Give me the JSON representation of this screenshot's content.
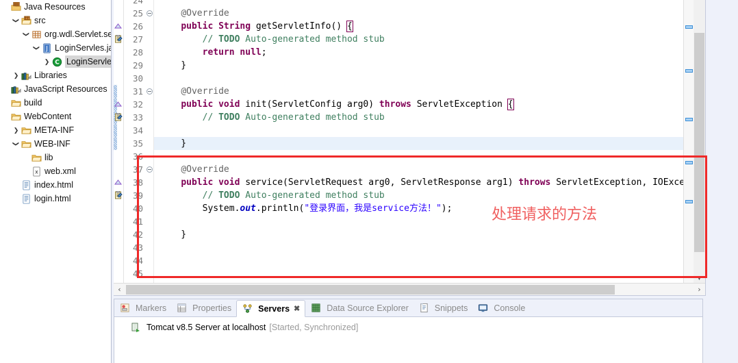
{
  "explorer": {
    "items": [
      {
        "label": "Java Resources",
        "icon": "java-resources-icon",
        "arrow": "",
        "indent": 0,
        "selected": false
      },
      {
        "label": "src",
        "icon": "source-folder-icon",
        "arrow": "v",
        "indent": 1,
        "selected": false
      },
      {
        "label": "org.wdl.Servlet.ser",
        "icon": "package-icon",
        "arrow": "v",
        "indent": 2,
        "selected": false
      },
      {
        "label": "LoginServles.jav",
        "icon": "java-file-icon",
        "arrow": "v",
        "indent": 3,
        "selected": false
      },
      {
        "label": "LoginServles",
        "icon": "java-class-icon",
        "arrow": ">",
        "indent": 4,
        "selected": true
      },
      {
        "label": "Libraries",
        "icon": "libraries-icon",
        "arrow": ">",
        "indent": 1,
        "selected": false
      },
      {
        "label": "JavaScript Resources",
        "icon": "libraries-icon",
        "arrow": "",
        "indent": 0,
        "selected": false
      },
      {
        "label": "build",
        "icon": "folder-icon",
        "arrow": "",
        "indent": 0,
        "selected": false
      },
      {
        "label": "WebContent",
        "icon": "folder-icon",
        "arrow": "",
        "indent": 0,
        "selected": false
      },
      {
        "label": "META-INF",
        "icon": "folder-icon",
        "arrow": ">",
        "indent": 1,
        "selected": false
      },
      {
        "label": "WEB-INF",
        "icon": "folder-icon",
        "arrow": "v",
        "indent": 1,
        "selected": false
      },
      {
        "label": "lib",
        "icon": "folder-icon",
        "arrow": "",
        "indent": 2,
        "selected": false
      },
      {
        "label": "web.xml",
        "icon": "xml-file-icon",
        "arrow": "",
        "indent": 2,
        "selected": false
      },
      {
        "label": "index.html",
        "icon": "html-file-icon",
        "arrow": "",
        "indent": 1,
        "selected": false
      },
      {
        "label": "login.html",
        "icon": "html-file-icon",
        "arrow": "",
        "indent": 1,
        "selected": false
      }
    ]
  },
  "editor": {
    "first_visible_line": 24,
    "lines": [
      {
        "n": 24,
        "text": "",
        "fold": false,
        "marker": "",
        "changebar": false,
        "current": false
      },
      {
        "n": 25,
        "text": "    @Override",
        "fold": true,
        "marker": "",
        "changebar": false,
        "current": false
      },
      {
        "n": 26,
        "text": "    public String getServletInfo() {",
        "fold": false,
        "marker": "override",
        "changebar": false,
        "current": false
      },
      {
        "n": 27,
        "text": "        // TODO Auto-generated method stub",
        "fold": false,
        "marker": "todo",
        "changebar": false,
        "current": false
      },
      {
        "n": 28,
        "text": "        return null;",
        "fold": false,
        "marker": "",
        "changebar": false,
        "current": false
      },
      {
        "n": 29,
        "text": "    }",
        "fold": false,
        "marker": "",
        "changebar": false,
        "current": false
      },
      {
        "n": 30,
        "text": "",
        "fold": false,
        "marker": "",
        "changebar": false,
        "current": false
      },
      {
        "n": 31,
        "text": "    @Override",
        "fold": true,
        "marker": "",
        "changebar": true,
        "current": false
      },
      {
        "n": 32,
        "text": "    public void init(ServletConfig arg0) throws ServletException {",
        "fold": false,
        "marker": "override",
        "changebar": true,
        "current": false
      },
      {
        "n": 33,
        "text": "        // TODO Auto-generated method stub",
        "fold": false,
        "marker": "todo",
        "changebar": true,
        "current": false
      },
      {
        "n": 34,
        "text": "",
        "fold": false,
        "marker": "",
        "changebar": true,
        "current": false
      },
      {
        "n": 35,
        "text": "    }",
        "fold": false,
        "marker": "",
        "changebar": true,
        "current": true
      },
      {
        "n": 36,
        "text": "",
        "fold": false,
        "marker": "",
        "changebar": false,
        "current": false
      },
      {
        "n": 37,
        "text": "    @Override",
        "fold": true,
        "marker": "",
        "changebar": false,
        "current": false
      },
      {
        "n": 38,
        "text": "    public void service(ServletRequest arg0, ServletResponse arg1) throws ServletException, IOExce",
        "fold": false,
        "marker": "override",
        "changebar": false,
        "current": false
      },
      {
        "n": 39,
        "text": "        // TODO Auto-generated method stub",
        "fold": false,
        "marker": "todo",
        "changebar": false,
        "current": false
      },
      {
        "n": 40,
        "text": "        System.out.println(\"登录界面，我是service方法！\");",
        "fold": false,
        "marker": "",
        "changebar": false,
        "current": false
      },
      {
        "n": 41,
        "text": "",
        "fold": false,
        "marker": "",
        "changebar": false,
        "current": false
      },
      {
        "n": 42,
        "text": "    }",
        "fold": false,
        "marker": "",
        "changebar": false,
        "current": false
      },
      {
        "n": 43,
        "text": "",
        "fold": false,
        "marker": "",
        "changebar": false,
        "current": false
      },
      {
        "n": 44,
        "text": "",
        "fold": false,
        "marker": "",
        "changebar": false,
        "current": false
      },
      {
        "n": 45,
        "text": "",
        "fold": false,
        "marker": "",
        "changebar": false,
        "current": false
      }
    ],
    "annotation_note": "处理请求的方法",
    "annotation_color": "#f06060",
    "highlight_box_color": "#ef2929",
    "scroll_left_arrow": "‹",
    "scroll_right_arrow": "›"
  },
  "bottom_panel": {
    "tabs": [
      {
        "label": "Markers",
        "icon": "markers-icon",
        "active": false,
        "closable": false
      },
      {
        "label": "Properties",
        "icon": "properties-icon",
        "active": false,
        "closable": false
      },
      {
        "label": "Servers",
        "icon": "servers-icon",
        "active": true,
        "closable": true
      },
      {
        "label": "Data Source Explorer",
        "icon": "data-source-icon",
        "active": false,
        "closable": false
      },
      {
        "label": "Snippets",
        "icon": "snippets-icon",
        "active": false,
        "closable": false
      },
      {
        "label": "Console",
        "icon": "console-icon",
        "active": false,
        "closable": false
      }
    ],
    "close_glyph": "✖",
    "server": {
      "name": "Tomcat v8.5 Server at localhost",
      "state": "[Started, Synchronized]",
      "icon": "server-icon"
    }
  }
}
